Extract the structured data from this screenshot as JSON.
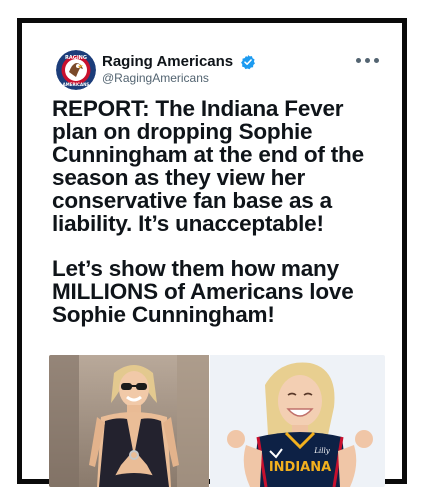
{
  "tweet": {
    "display_name": "Raging Americans",
    "handle": "@RagingAmericans",
    "verified": true,
    "paragraph_1": "REPORT: The Indiana Fever plan on dropping Sophie Cunningham at the end of the season as they view her conservative fan base as a liability. It’s unacceptable!",
    "paragraph_2": "Let’s show them how many MILLIONS of Americans love Sophie Cunningham!"
  },
  "avatar": {
    "logo_text_top": "RAGING",
    "logo_text_bottom": "AMERICANS"
  },
  "media": {
    "jersey_text": "INDIANA",
    "jersey_logo_text": "Lilly"
  },
  "colors": {
    "text": "#0f1419",
    "muted": "#536471",
    "verified_blue": "#1d9bf0",
    "frame": "#0a0a0a",
    "jersey_navy": "#0d2145",
    "jersey_gold": "#f2b01e"
  },
  "icons": [
    "verified-badge-icon",
    "more-options-icon"
  ]
}
